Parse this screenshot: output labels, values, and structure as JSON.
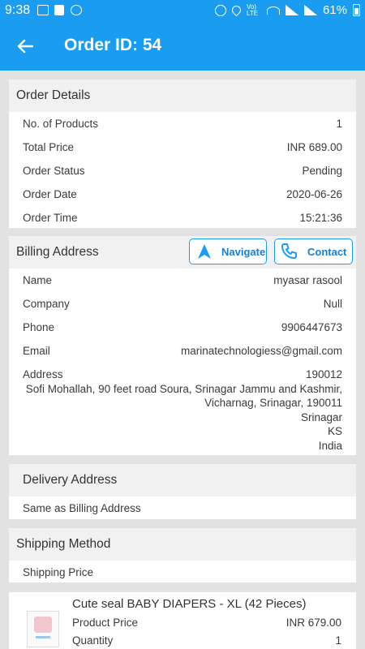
{
  "status_bar": {
    "time": "9:38",
    "battery": "61%",
    "network": "Vo) LTE"
  },
  "app_bar": {
    "title": "Order ID: 54"
  },
  "order_details": {
    "header": "Order Details",
    "rows": [
      {
        "label": "No. of Products",
        "value": "1"
      },
      {
        "label": "Total Price",
        "value": "INR 689.00"
      },
      {
        "label": "Order Status",
        "value": "Pending"
      },
      {
        "label": "Order Date",
        "value": "2020-06-26"
      },
      {
        "label": "Order Time",
        "value": "15:21:36"
      }
    ]
  },
  "billing": {
    "header": "Billing Address",
    "navigate_label": "Navigate",
    "contact_label": "Contact",
    "rows": [
      {
        "label": "Name",
        "value": "myasar rasool"
      },
      {
        "label": "Company",
        "value": "Null"
      },
      {
        "label": "Phone",
        "value": "9906447673"
      },
      {
        "label": "Email",
        "value": "marinatechnologiess@gmail.com"
      }
    ],
    "address": {
      "label": "Address",
      "zip": "190012",
      "line1": "Sofi Mohallah, 90 feet road Soura, Srinagar Jammu and Kashmir,",
      "line2": "Vicharnag, Srinagar, 190011",
      "city": "Srinagar",
      "state": "KS",
      "country": "India"
    }
  },
  "delivery": {
    "header": "Delivery Address",
    "text": "Same as Billing Address"
  },
  "shipping": {
    "header": "Shipping Method",
    "price_label": "Shipping Price"
  },
  "product": {
    "name": "Cute seal BABY DIAPERS - XL  (42 Pieces)",
    "price_label": "Product Price",
    "price_value": "INR 679.00",
    "qty_label": "Quantity",
    "qty_value": "1"
  },
  "colors": {
    "primary": "#1a9cf0",
    "background": "#e2e2e2",
    "header_bg": "#f1f1f1"
  }
}
